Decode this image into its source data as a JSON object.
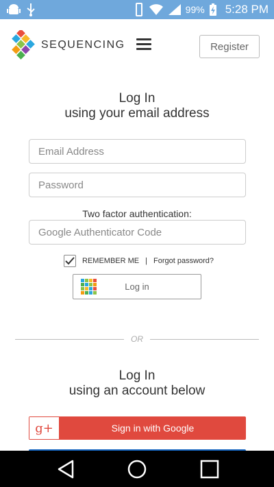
{
  "status_bar": {
    "battery_percent": "99%",
    "time": "5:28 PM",
    "icons": [
      "android-debug-icon",
      "usb-icon",
      "vibrate-icon",
      "wifi-icon",
      "signal-icon",
      "battery-charging-icon"
    ]
  },
  "header": {
    "brand": "SEQUENCING",
    "menu_icon": "hamburger-icon",
    "register_label": "Register"
  },
  "login_email": {
    "title": "Log In",
    "subtitle": "using your email address"
  },
  "form": {
    "email_placeholder": "Email Address",
    "password_placeholder": "Password",
    "tfa_label": "Two factor authentication:",
    "tfa_placeholder": "Google Authenticator Code",
    "remember_label": "REMEMBER ME",
    "remember_checked": true,
    "separator": "|",
    "forgot_label": "Forgot password?",
    "login_label": "Log in"
  },
  "divider": {
    "text": "OR"
  },
  "login_account": {
    "title": "Log In",
    "subtitle": "using an account below"
  },
  "social": {
    "google_icon_text": "g+",
    "google_label": "Sign in with Google"
  },
  "colors": {
    "status_bar": "#6fa8dc",
    "google_red": "#e0493e",
    "facebook_blue": "#1565c0"
  }
}
